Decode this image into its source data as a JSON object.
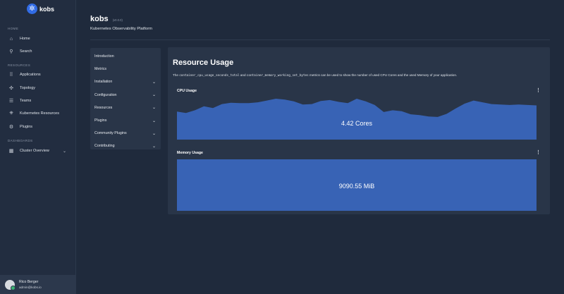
{
  "sidebar": {
    "brand": "kobs",
    "home_section": "HOME",
    "home_items": [
      {
        "label": "Home",
        "icon": "home-icon"
      },
      {
        "label": "Search",
        "icon": "search-icon"
      }
    ],
    "resources_section": "RESOURCES",
    "resource_items": [
      {
        "label": "Applications",
        "icon": "grid-icon"
      },
      {
        "label": "Topology",
        "icon": "topology-icon"
      },
      {
        "label": "Teams",
        "icon": "teams-icon"
      },
      {
        "label": "Kubernetes Resources",
        "icon": "kubernetes-icon"
      },
      {
        "label": "Plugins",
        "icon": "plugin-icon"
      }
    ],
    "dashboards_section": "DASHBOARDS",
    "dashboard_items": [
      {
        "label": "Cluster Overview",
        "icon": "dashboard-icon"
      }
    ],
    "user": {
      "name": "Rico Berger",
      "email": "admin@kobs.io"
    }
  },
  "header": {
    "title": "kobs",
    "version": "(v0.0.0)",
    "subtitle": "Kubernetes Observability Platform"
  },
  "doc_nav": {
    "items": [
      {
        "label": "Introduction",
        "expandable": false
      },
      {
        "label": "Metrics",
        "expandable": false
      },
      {
        "label": "Installation",
        "expandable": true
      },
      {
        "label": "Configuration",
        "expandable": true
      },
      {
        "label": "Resources",
        "expandable": true
      },
      {
        "label": "Plugins",
        "expandable": true
      },
      {
        "label": "Community Plugins",
        "expandable": true
      },
      {
        "label": "Contributing",
        "expandable": true
      }
    ]
  },
  "main": {
    "title": "Resource Usage",
    "desc_prefix": "The ",
    "metric_1": "container_cpu_usage_seconds_total",
    "desc_and": " and ",
    "metric_2": "container_memory_working_set_bytes",
    "desc_suffix": " metrics can be used to show the number of used CPU Cores and the used Memory of your application.",
    "cpu_panel": {
      "title": "CPU Usage",
      "value": "4.42 Cores",
      "menu": "⋮"
    },
    "memory_panel": {
      "title": "Memory Usage",
      "value": "9090.55 MiB",
      "menu": "⋮"
    }
  },
  "colors": {
    "background": "#1f2a3c",
    "card": "#293548",
    "accent": "#3863b5",
    "brand": "#326ce5"
  },
  "chart_data": {
    "type": "area",
    "series": [
      {
        "values": [
          0.63,
          0.6,
          0.66,
          0.75,
          0.71,
          0.8,
          0.83,
          0.82,
          0.82,
          0.84,
          0.88,
          0.92,
          0.9,
          0.86,
          0.79,
          0.8,
          0.87,
          0.89,
          0.85,
          0.82,
          0.92,
          0.86,
          0.78,
          0.62,
          0.66,
          0.64,
          0.57,
          0.55,
          0.52,
          0.51,
          0.58,
          0.7,
          0.81,
          0.88,
          0.84,
          0.8,
          0.79,
          0.78,
          0.79,
          0.78,
          0.77
        ]
      }
    ],
    "ylim": [
      0,
      1
    ],
    "grid": false
  }
}
